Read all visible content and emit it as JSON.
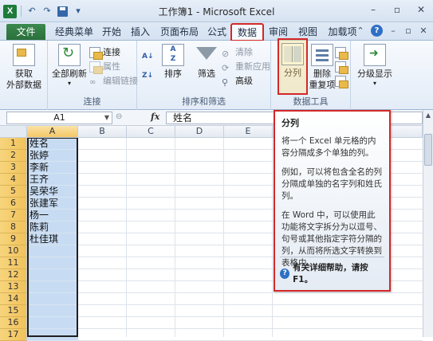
{
  "window": {
    "title": "工作簿1 - Microsoft Excel"
  },
  "qat": {
    "logo": "X",
    "undo": "↶",
    "redo": "↷"
  },
  "window_controls": {
    "minimize": "–",
    "restore": "▫",
    "close": "✕"
  },
  "tabs": [
    {
      "label": "文件"
    },
    {
      "label": "经典菜单"
    },
    {
      "label": "开始"
    },
    {
      "label": "插入"
    },
    {
      "label": "页面布局"
    },
    {
      "label": "公式"
    },
    {
      "label": "数据"
    },
    {
      "label": "审阅"
    },
    {
      "label": "视图"
    },
    {
      "label": "加载项"
    }
  ],
  "ribbon": {
    "get_external": {
      "line1": "获取",
      "line2": "外部数据"
    },
    "connections": {
      "refresh_all": "全部刷新",
      "connect": "连接",
      "properties": "属性",
      "edit_links": "编辑链接",
      "label": "连接"
    },
    "sort_filter": {
      "sort": "排序",
      "filter": "筛选",
      "clear": "清除",
      "reapply": "重新应用",
      "advanced": "高级",
      "label": "排序和筛选"
    },
    "data_tools": {
      "text_to_columns": "分列",
      "remove_dup_line1": "删除",
      "remove_dup_line2": "重复项",
      "label": "数据工具"
    },
    "outline": {
      "label": "分级显示"
    }
  },
  "formula_bar": {
    "name_box": "A1",
    "fx": "fx",
    "content": "姓名"
  },
  "sheet": {
    "columns": [
      "A",
      "B",
      "C",
      "D",
      "E"
    ],
    "rows": [
      "1",
      "2",
      "3",
      "4",
      "5",
      "6",
      "7",
      "8",
      "9",
      "10",
      "11",
      "12",
      "13",
      "14",
      "15",
      "16",
      "17"
    ],
    "column_a": [
      "姓名",
      "张婷",
      "李新",
      "王齐",
      "吴荣华",
      "张建军",
      "杨一",
      "陈莉",
      "杜佳琪",
      "",
      "",
      "",
      "",
      "",
      "",
      "",
      ""
    ]
  },
  "tooltip": {
    "title": "分列",
    "p1": "将一个 Excel 单元格的内容分隔成多个单独的列。",
    "p2": "例如，可以将包含全名的列分隔成单独的名字列和姓氏列。",
    "p3": "在 Word 中，可以使用此功能将文字拆分为以逗号、句号或其他指定字符分隔的列，从而将所选文字转换到表格中。",
    "footer": "有关详细帮助，请按 F1。"
  },
  "colors": {
    "accent_red": "#d32828",
    "file_tab": "#2a6f3c",
    "selection": "#c7dcf3"
  }
}
